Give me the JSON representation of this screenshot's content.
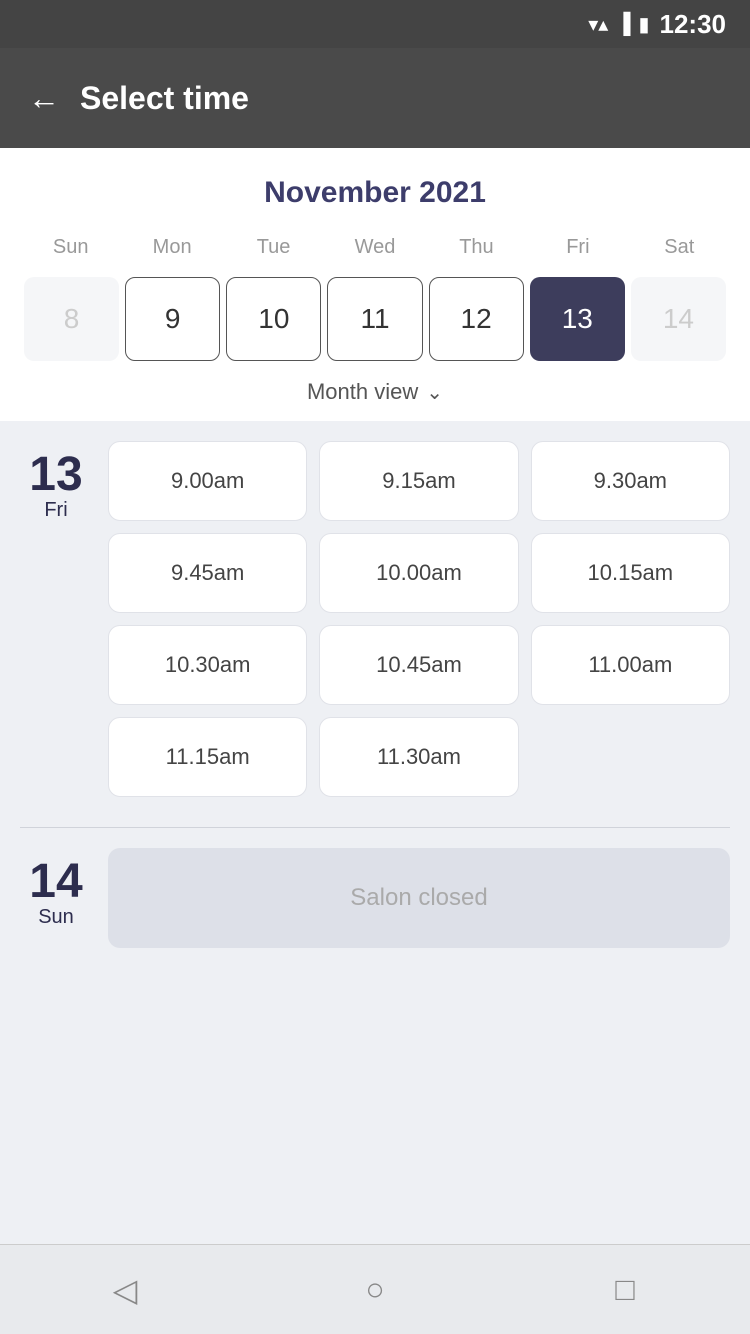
{
  "statusBar": {
    "time": "12:30"
  },
  "header": {
    "title": "Select time",
    "backLabel": "←"
  },
  "calendar": {
    "monthTitle": "November 2021",
    "weekdays": [
      "Sun",
      "Mon",
      "Tue",
      "Wed",
      "Thu",
      "Fri",
      "Sat"
    ],
    "days": [
      {
        "number": "8",
        "state": "inactive"
      },
      {
        "number": "9",
        "state": "active"
      },
      {
        "number": "10",
        "state": "active"
      },
      {
        "number": "11",
        "state": "active"
      },
      {
        "number": "12",
        "state": "active"
      },
      {
        "number": "13",
        "state": "selected"
      },
      {
        "number": "14",
        "state": "inactive"
      }
    ],
    "monthViewLabel": "Month view"
  },
  "timeSections": [
    {
      "dayNumber": "13",
      "dayName": "Fri",
      "slots": [
        "9.00am",
        "9.15am",
        "9.30am",
        "9.45am",
        "10.00am",
        "10.15am",
        "10.30am",
        "10.45am",
        "11.00am",
        "11.15am",
        "11.30am"
      ]
    },
    {
      "dayNumber": "14",
      "dayName": "Sun",
      "closed": true,
      "closedLabel": "Salon closed"
    }
  ],
  "bottomNav": {
    "back": "◁",
    "home": "○",
    "recent": "□"
  }
}
